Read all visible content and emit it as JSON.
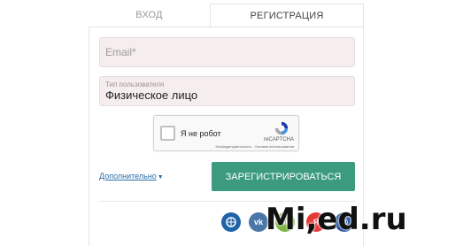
{
  "tabs": {
    "login": "Вход",
    "register": "Регистрация"
  },
  "form": {
    "email_placeholder": "Email*",
    "user_type_label": "Тип пользователя",
    "user_type_value": "Физическое лицо"
  },
  "captcha": {
    "label": "Я не робот",
    "brand": "reCAPTCHA",
    "links": "Конфиденциальность - Условия использования"
  },
  "more_link": "Дополнительно",
  "register_button": "Зарегистрироваться",
  "social": [
    "webmoney-icon",
    "vk-icon",
    "odnoklassniki-icon",
    "yandex-icon",
    "mailru-icon"
  ],
  "watermark": "Mi,ed.ru",
  "colors": {
    "accent": "#3c9a7f",
    "link": "#2b6ea8",
    "field_bg": "#f6eeee"
  }
}
